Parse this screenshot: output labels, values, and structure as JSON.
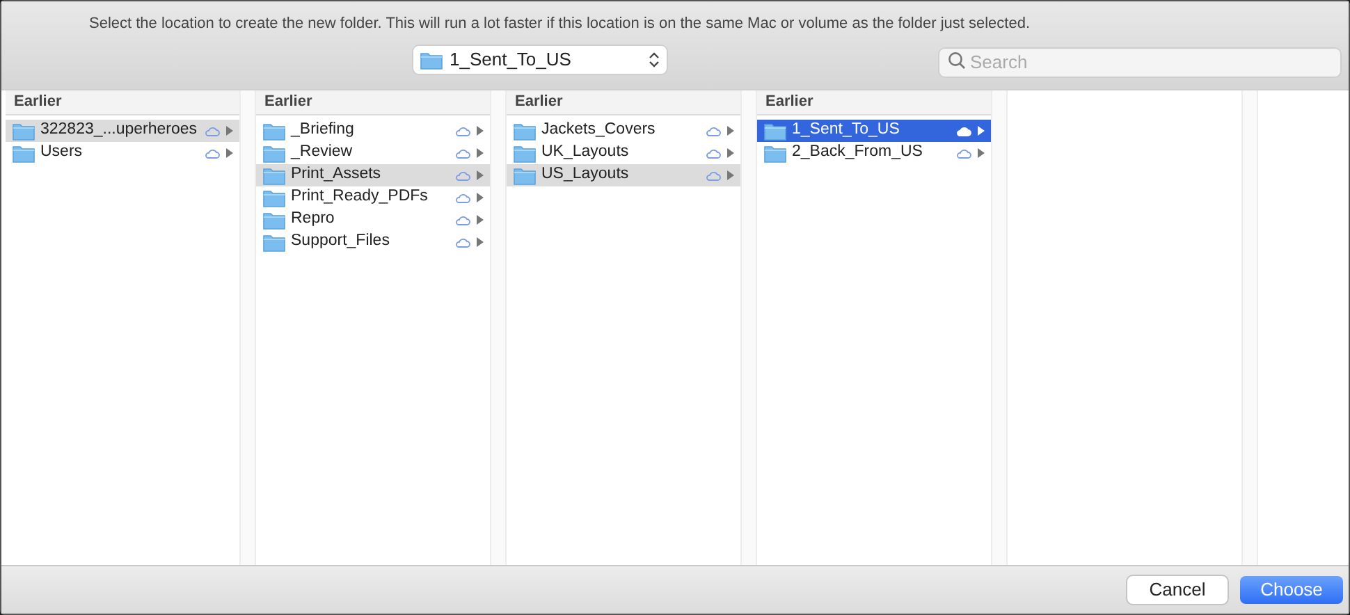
{
  "prompt": "Select the location to create the new folder. This will run a lot faster if this location is on the same Mac or volume as the folder just selected.",
  "location_popup": {
    "value": "1_Sent_To_US"
  },
  "search": {
    "placeholder": "Search"
  },
  "columns": [
    {
      "header": "Earlier",
      "focused": false,
      "items": [
        {
          "name": "322823_...uperheroes",
          "selected": true
        },
        {
          "name": "Users",
          "selected": false
        }
      ]
    },
    {
      "header": "Earlier",
      "focused": false,
      "items": [
        {
          "name": "_Briefing",
          "selected": false
        },
        {
          "name": "_Review",
          "selected": false
        },
        {
          "name": "Print_Assets",
          "selected": true
        },
        {
          "name": "Print_Ready_PDFs",
          "selected": false
        },
        {
          "name": "Repro",
          "selected": false
        },
        {
          "name": "Support_Files",
          "selected": false
        }
      ]
    },
    {
      "header": "Earlier",
      "focused": false,
      "items": [
        {
          "name": "Jackets_Covers",
          "selected": false
        },
        {
          "name": "UK_Layouts",
          "selected": false
        },
        {
          "name": "US_Layouts",
          "selected": true
        }
      ]
    },
    {
      "header": "Earlier",
      "focused": true,
      "items": [
        {
          "name": "1_Sent_To_US",
          "selected": true
        },
        {
          "name": "2_Back_From_US",
          "selected": false
        }
      ]
    }
  ],
  "buttons": [
    {
      "label": "Cancel",
      "kind": "secondary"
    },
    {
      "label": "Choose",
      "kind": "primary"
    }
  ]
}
